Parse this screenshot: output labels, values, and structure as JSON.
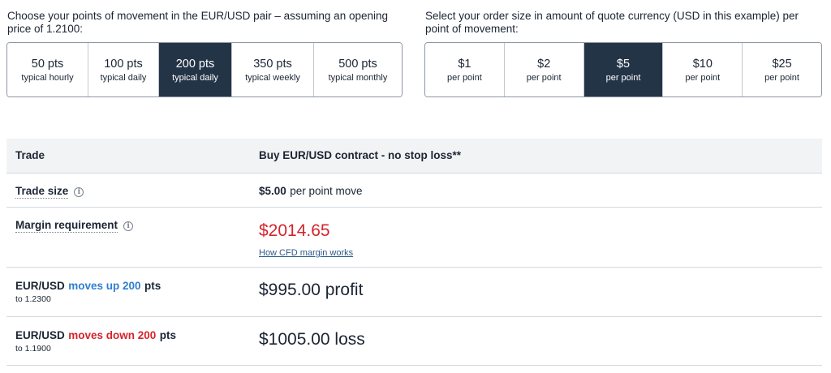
{
  "points_prompt": "Choose your points of movement in the EUR/USD pair – assuming an opening price of 1.2100:",
  "size_prompt": "Select your order size in amount of quote currency (USD in this example) per point of movement:",
  "points_options": [
    {
      "main": "50 pts",
      "sub": "typical hourly",
      "selected": false
    },
    {
      "main": "100 pts",
      "sub": "typical daily",
      "selected": false
    },
    {
      "main": "200 pts",
      "sub": "typical daily",
      "selected": true
    },
    {
      "main": "350 pts",
      "sub": "typical weekly",
      "selected": false
    },
    {
      "main": "500 pts",
      "sub": "typical monthly",
      "selected": false
    }
  ],
  "size_options": [
    {
      "main": "$1",
      "sub": "per point",
      "selected": false
    },
    {
      "main": "$2",
      "sub": "per point",
      "selected": false
    },
    {
      "main": "$5",
      "sub": "per point",
      "selected": true
    },
    {
      "main": "$10",
      "sub": "per point",
      "selected": false
    },
    {
      "main": "$25",
      "sub": "per point",
      "selected": false
    }
  ],
  "table": {
    "header": {
      "label": "Trade",
      "value": "Buy EUR/USD contract - no stop loss**"
    },
    "trade_size": {
      "label": "Trade size",
      "amount": "$5.00",
      "suffix": "per point move",
      "info_icon": "info-icon"
    },
    "margin": {
      "label": "Margin requirement",
      "amount": "$2014.65",
      "link": "How CFD margin works",
      "info_icon": "info-icon"
    },
    "up": {
      "pair": "EUR/USD",
      "move": "moves up 200",
      "unit": "pts",
      "to": "to 1.2300",
      "result": "$995.00 profit"
    },
    "down": {
      "pair": "EUR/USD",
      "move": "moves down 200",
      "unit": "pts",
      "to": "to 1.1900",
      "result": "$1005.00 loss"
    }
  },
  "colors": {
    "selected_bg": "#243447",
    "profit_link": "#2f7fd0",
    "loss": "#d4242b"
  }
}
